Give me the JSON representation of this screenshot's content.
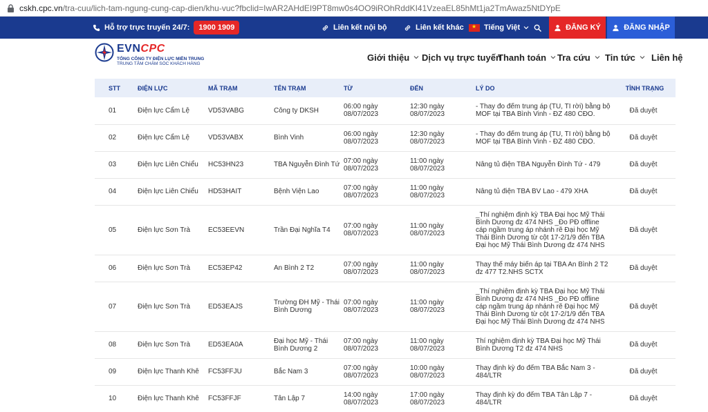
{
  "browser": {
    "url_host": "cskh.cpc.vn",
    "url_path": "/tra-cuu/lich-tam-ngung-cung-cap-dien/khu-vuc?fbclid=IwAR2AHdEI9PT8mw0s4OO9iROhRddKI41VzeaEL85hMt1ja2TmAwaz5NtDYpE"
  },
  "topbar": {
    "hotline_label": "Hỗ trợ trực truyến 24/7:",
    "hotline_number": "1900 1909",
    "internal_link": "Liên kết nội bộ",
    "other_link": "Liên kết khác",
    "language": "Tiếng Việt",
    "register": "ĐĂNG KÝ",
    "login": "ĐĂNG NHẬP"
  },
  "logo": {
    "brand_evn": "EVN",
    "brand_cpc": "CPC",
    "sub1": "TỔNG CÔNG TY ĐIỆN LỰC MIỀN TRUNG",
    "sub2": "TRUNG TÂM CHĂM SÓC KHÁCH HÀNG"
  },
  "nav": [
    {
      "label": "Giới thiệu",
      "dropdown": true
    },
    {
      "label": "Dịch vụ trực tuyến",
      "dropdown": false
    },
    {
      "label": "Thanh toán",
      "dropdown": true
    },
    {
      "label": "Tra cứu",
      "dropdown": true
    },
    {
      "label": "Tin tức",
      "dropdown": true
    },
    {
      "label": "Liên hệ",
      "dropdown": false
    }
  ],
  "table": {
    "headers": [
      "STT",
      "ĐIỆN LỰC",
      "MÃ TRẠM",
      "TÊN TRẠM",
      "TỪ",
      "ĐẾN",
      "LÝ DO",
      "TÌNH TRẠNG"
    ],
    "rows": [
      {
        "stt": "01",
        "dienluc": "Điện lực Cẩm Lệ",
        "ma": "VD53VABG",
        "ten": "Công ty DKSH",
        "tu_time": "06:00 ngày",
        "tu_date": "08/07/2023",
        "den_time": "12:30 ngày",
        "den_date": "08/07/2023",
        "lydo": "- Thay đo đếm trung áp (TU, TI rời) bằng bộ MOF tại TBA Bình Vinh - ĐZ 480 CĐO.",
        "status": "Đã duyệt"
      },
      {
        "stt": "02",
        "dienluc": "Điện lực Cẩm Lệ",
        "ma": "VD53VABX",
        "ten": "Bình Vinh",
        "tu_time": "06:00 ngày",
        "tu_date": "08/07/2023",
        "den_time": "12:30 ngày",
        "den_date": "08/07/2023",
        "lydo": "- Thay đo đếm trung áp (TU, TI rời) bằng bộ MOF tại TBA Bình Vinh - ĐZ 480 CĐO.",
        "status": "Đã duyệt"
      },
      {
        "stt": "03",
        "dienluc": "Điện lực Liên Chiểu",
        "ma": "HC53HN23",
        "ten": "TBA Nguyễn Đình Tứ",
        "tu_time": "07:00 ngày",
        "tu_date": "08/07/2023",
        "den_time": "11:00 ngày",
        "den_date": "08/07/2023",
        "lydo": "Nâng tủ điện TBA Nguyễn Đình Tứ - 479",
        "status": "Đã duyệt"
      },
      {
        "stt": "04",
        "dienluc": "Điện lực Liên Chiểu",
        "ma": "HD53HAIT",
        "ten": "Bệnh Viện Lao",
        "tu_time": "07:00 ngày",
        "tu_date": "08/07/2023",
        "den_time": "11:00 ngày",
        "den_date": "08/07/2023",
        "lydo": "Nâng tủ điện TBA BV Lao - 479 XHA",
        "status": "Đã duyệt"
      },
      {
        "stt": "05",
        "dienluc": "Điện lực Sơn Trà",
        "ma": "EC53EEVN",
        "ten": "Trần Đại Nghĩa T4",
        "tu_time": "07:00 ngày",
        "tu_date": "08/07/2023",
        "den_time": "11:00 ngày",
        "den_date": "08/07/2023",
        "lydo": "_Thí nghiệm định kỳ TBA Đại học Mỹ Thái Bình Dương đz 474 NHS _Đo PĐ offline cáp ngầm trung áp nhánh rẽ Đại học Mỹ Thái Bình Dương từ cột 17-2/1/9 đến TBA Đại học Mỹ Thái Bình Dương đz 474 NHS",
        "status": "Đã duyệt"
      },
      {
        "stt": "06",
        "dienluc": "Điện lực Sơn Trà",
        "ma": "EC53EP42",
        "ten": "An Bình 2 T2",
        "tu_time": "07:00 ngày",
        "tu_date": "08/07/2023",
        "den_time": "11:00 ngày",
        "den_date": "08/07/2023",
        "lydo": "Thay thế máy biến áp tại TBA An Bình 2 T2 đz 477 T2.NHS SCTX",
        "status": "Đã duyệt"
      },
      {
        "stt": "07",
        "dienluc": "Điện lực Sơn Trà",
        "ma": "ED53EAJS",
        "ten": "Trường ĐH Mỹ - Thái Bình Dương",
        "tu_time": "07:00 ngày",
        "tu_date": "08/07/2023",
        "den_time": "11:00 ngày",
        "den_date": "08/07/2023",
        "lydo": "_Thí nghiệm định kỳ TBA Đại học Mỹ Thái Bình Dương đz 474 NHS _Đo PĐ offline cáp ngầm trung áp nhánh rẽ Đại học Mỹ Thái Bình Dương từ cột 17-2/1/9 đến TBA Đại học Mỹ Thái Bình Dương đz 474 NHS",
        "status": "Đã duyệt"
      },
      {
        "stt": "08",
        "dienluc": "Điện lực Sơn Trà",
        "ma": "ED53EA0A",
        "ten": "Đại học Mỹ - Thái Bình Dương 2",
        "tu_time": "07:00 ngày",
        "tu_date": "08/07/2023",
        "den_time": "11:00 ngày",
        "den_date": "08/07/2023",
        "lydo": "Thí nghiệm định kỳ TBA Đại học Mỹ Thái Bình Dương T2 đz 474 NHS",
        "status": "Đã duyệt"
      },
      {
        "stt": "09",
        "dienluc": "Điện lực Thanh Khê",
        "ma": "FC53FFJU",
        "ten": "Bắc Nam 3",
        "tu_time": "07:00 ngày",
        "tu_date": "08/07/2023",
        "den_time": "10:00 ngày",
        "den_date": "08/07/2023",
        "lydo": "Thay định kỳ đo đếm TBA Bắc Nam 3 - 484/LTR",
        "status": "Đã duyệt"
      },
      {
        "stt": "10",
        "dienluc": "Điện lực Thanh Khê",
        "ma": "FC53FFJF",
        "ten": "Tân Lập 7",
        "tu_time": "14:00 ngày",
        "tu_date": "08/07/2023",
        "den_time": "17:00 ngày",
        "den_date": "08/07/2023",
        "lydo": "Thay định kỳ đo đếm TBA Tân Lập 7 - 484/LTR",
        "status": "Đã duyệt"
      }
    ]
  }
}
